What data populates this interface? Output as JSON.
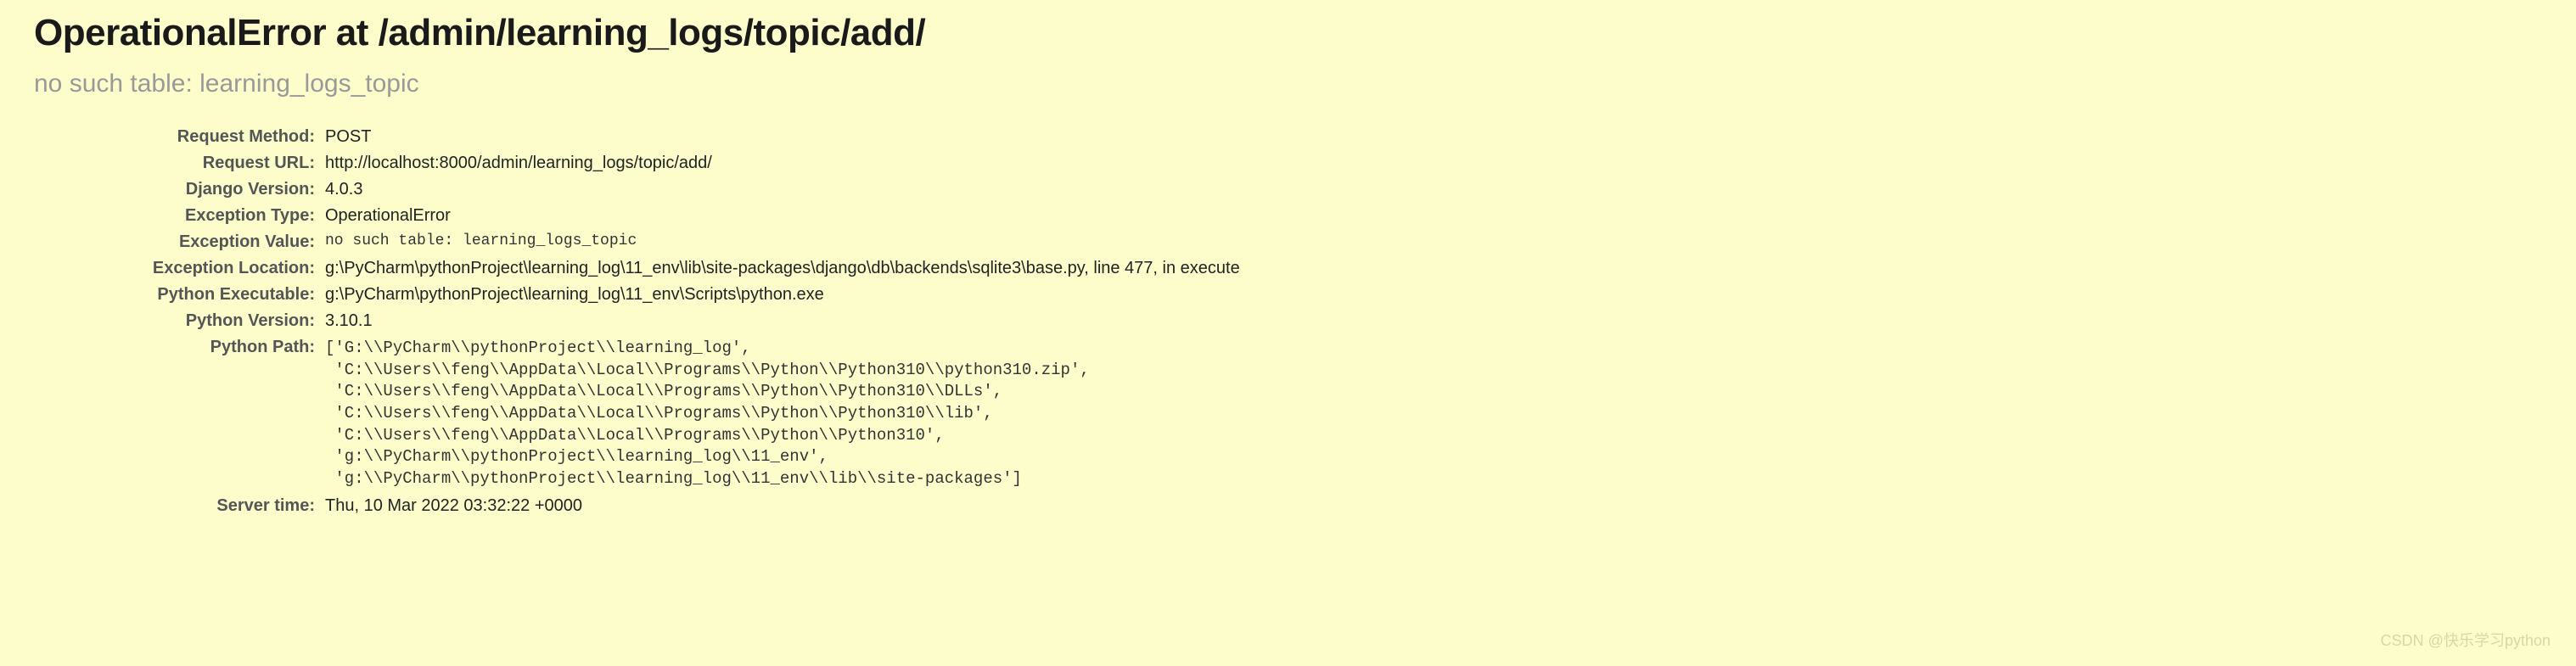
{
  "error": {
    "title": "OperationalError at /admin/learning_logs/topic/add/",
    "subtitle": "no such table: learning_logs_topic"
  },
  "details": {
    "request_method": {
      "label": "Request Method:",
      "value": "POST"
    },
    "request_url": {
      "label": "Request URL:",
      "value": "http://localhost:8000/admin/learning_logs/topic/add/"
    },
    "django_version": {
      "label": "Django Version:",
      "value": "4.0.3"
    },
    "exception_type": {
      "label": "Exception Type:",
      "value": "OperationalError"
    },
    "exception_value": {
      "label": "Exception Value:",
      "value": "no such table: learning_logs_topic"
    },
    "exception_location": {
      "label": "Exception Location:",
      "value": "g:\\PyCharm\\pythonProject\\learning_log\\11_env\\lib\\site-packages\\django\\db\\backends\\sqlite3\\base.py, line 477, in execute"
    },
    "python_executable": {
      "label": "Python Executable:",
      "value": "g:\\PyCharm\\pythonProject\\learning_log\\11_env\\Scripts\\python.exe"
    },
    "python_version": {
      "label": "Python Version:",
      "value": "3.10.1"
    },
    "python_path": {
      "label": "Python Path:",
      "value": "['G:\\\\PyCharm\\\\pythonProject\\\\learning_log',\n 'C:\\\\Users\\\\feng\\\\AppData\\\\Local\\\\Programs\\\\Python\\\\Python310\\\\python310.zip',\n 'C:\\\\Users\\\\feng\\\\AppData\\\\Local\\\\Programs\\\\Python\\\\Python310\\\\DLLs',\n 'C:\\\\Users\\\\feng\\\\AppData\\\\Local\\\\Programs\\\\Python\\\\Python310\\\\lib',\n 'C:\\\\Users\\\\feng\\\\AppData\\\\Local\\\\Programs\\\\Python\\\\Python310',\n 'g:\\\\PyCharm\\\\pythonProject\\\\learning_log\\\\11_env',\n 'g:\\\\PyCharm\\\\pythonProject\\\\learning_log\\\\11_env\\\\lib\\\\site-packages']"
    },
    "server_time": {
      "label": "Server time:",
      "value": "Thu, 10 Mar 2022 03:32:22 +0000"
    }
  },
  "watermark": "CSDN @快乐学习python"
}
